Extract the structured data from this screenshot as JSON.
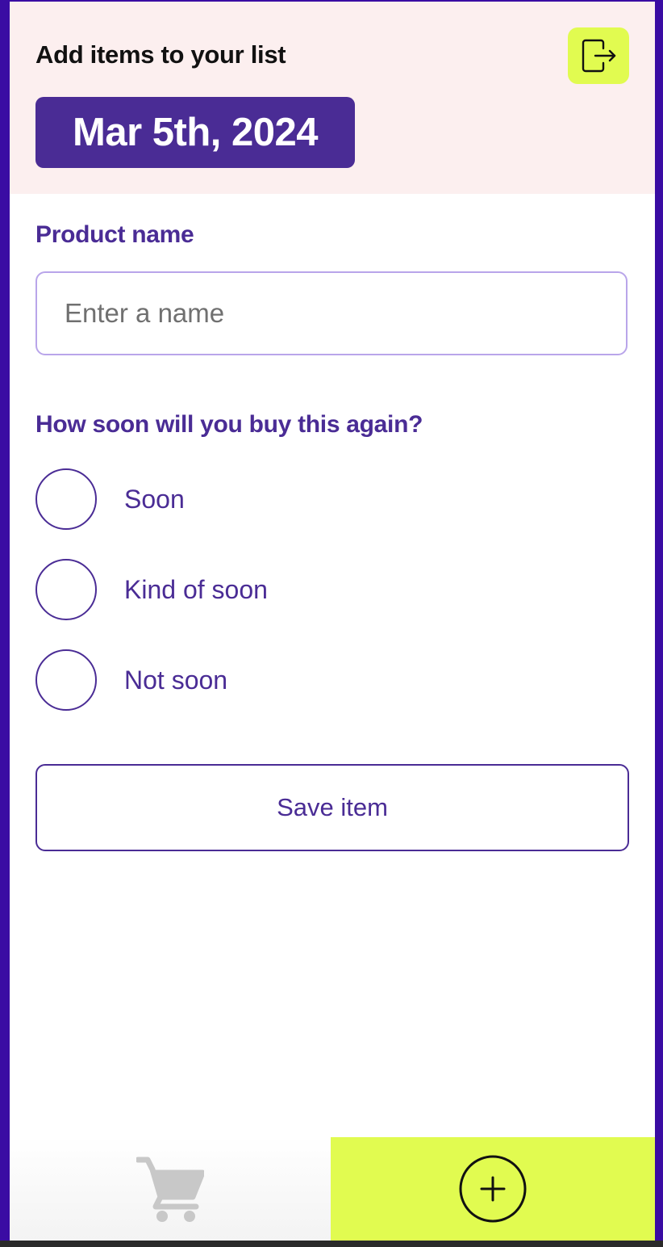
{
  "header": {
    "title": "Add items to your list",
    "date": "Mar 5th, 2024",
    "logout_icon": "logout-icon"
  },
  "form": {
    "product_label": "Product name",
    "product_placeholder": "Enter a name",
    "product_value": "",
    "frequency_label": "How soon will you buy this again?",
    "options": [
      {
        "label": "Soon",
        "selected": false
      },
      {
        "label": "Kind of soon",
        "selected": false
      },
      {
        "label": "Not soon",
        "selected": false
      }
    ],
    "save_label": "Save item"
  },
  "nav": {
    "list_icon": "shopping-cart-icon",
    "add_icon": "plus-circle-icon",
    "active": "add"
  },
  "colors": {
    "frame": "#3a0ca3",
    "primary": "#4a2c95",
    "accent": "#e1fb50",
    "header_bg": "#fcefef",
    "input_border": "#b9a5ea",
    "inactive_icon": "#c8c8c8"
  }
}
